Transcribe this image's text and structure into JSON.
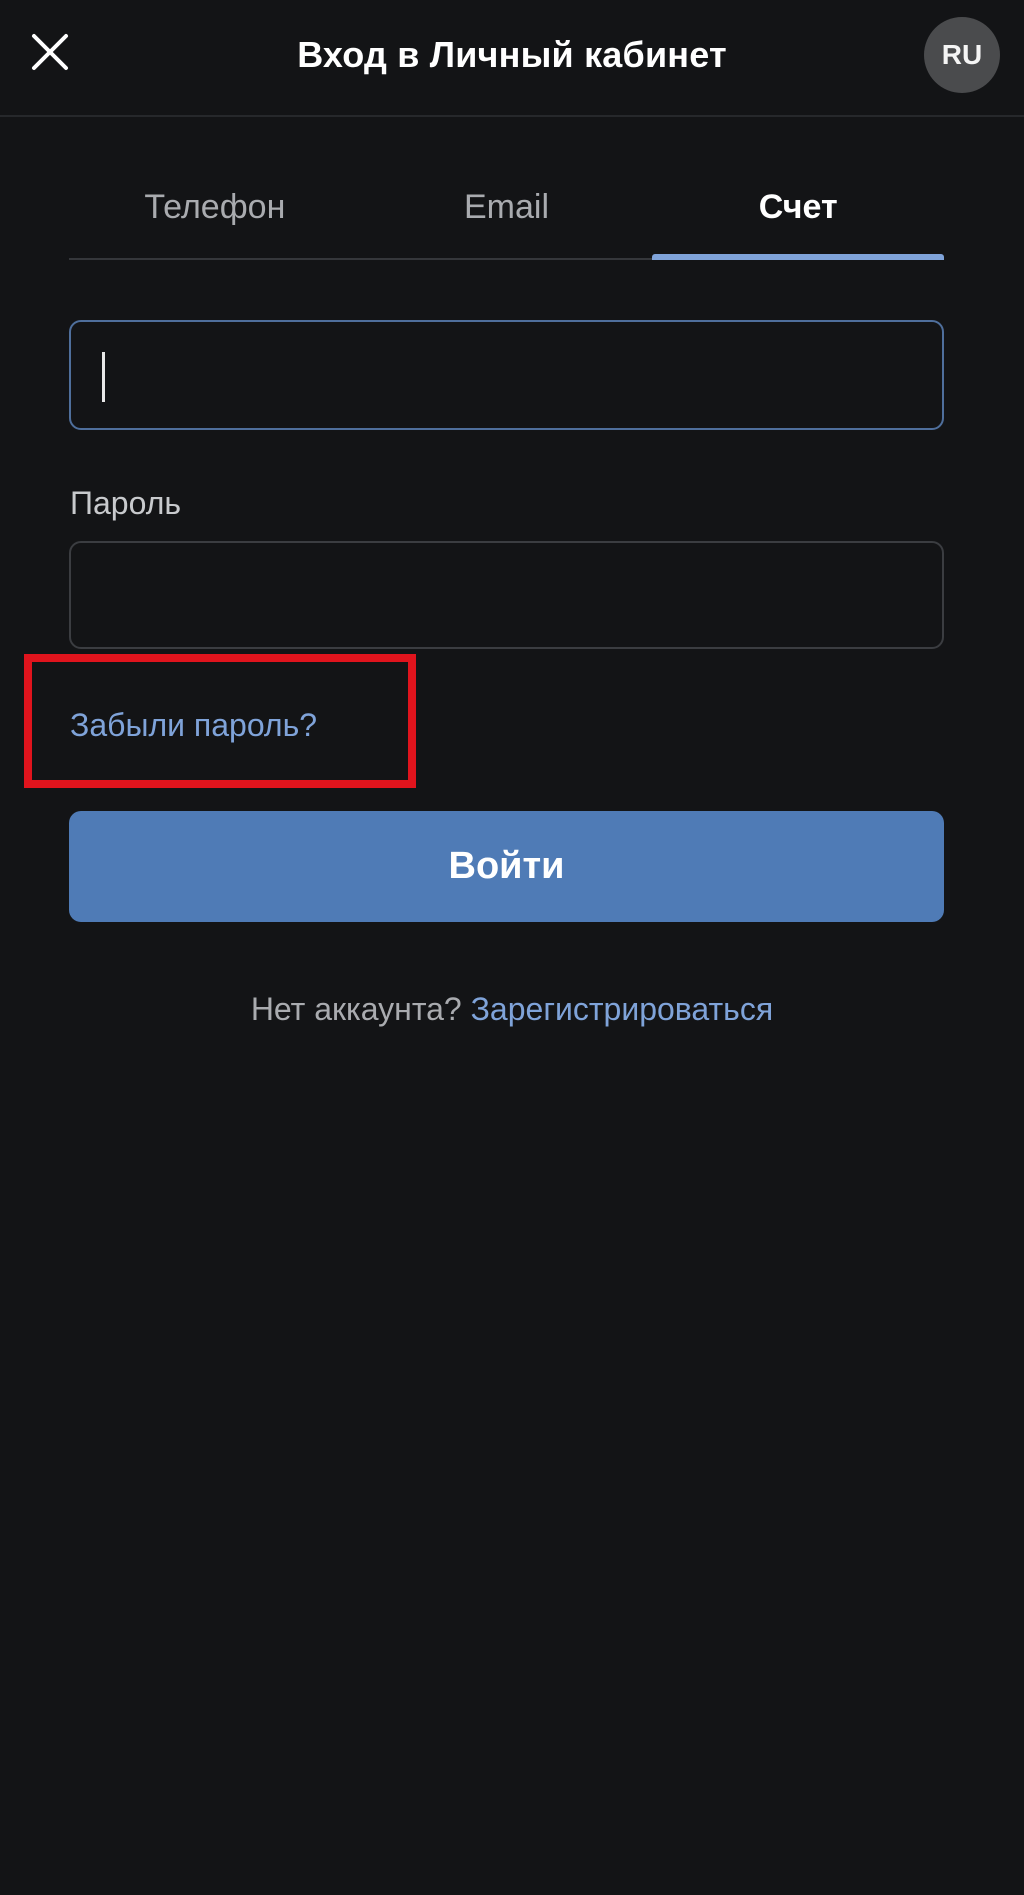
{
  "header": {
    "close_icon": "close-icon",
    "title": "Вход в Личный кабинет",
    "language": "RU"
  },
  "tabs": [
    {
      "label": "Телефон",
      "active": false
    },
    {
      "label": "Email",
      "active": false
    },
    {
      "label": "Счет",
      "active": true
    }
  ],
  "form": {
    "account_input_value": "",
    "password_label": "Пароль",
    "password_value": "",
    "forgot_password": "Забыли пароль?",
    "login_button": "Войти"
  },
  "signup": {
    "prompt": "Нет аккаунта?",
    "link": "Зарегистрироваться"
  },
  "colors": {
    "background": "#131416",
    "accent": "#7fa3d9",
    "button": "#4f7bb6",
    "highlight": "#e0141d"
  }
}
